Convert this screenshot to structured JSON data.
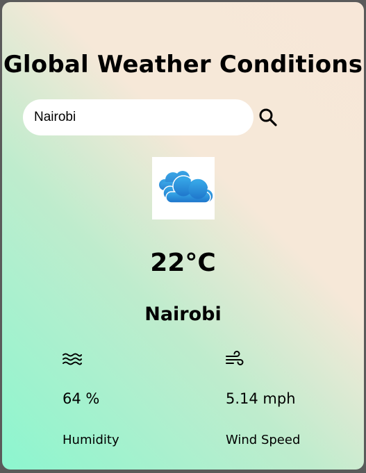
{
  "app": {
    "title": "Global Weather Conditions"
  },
  "search": {
    "value": "Nairobi"
  },
  "weather": {
    "icon": "cloud-icon",
    "temperature": "22°C",
    "city": "Nairobi"
  },
  "stats": {
    "humidity": {
      "icon": "humidity-waves-icon",
      "value": "64 %",
      "label": "Humidity"
    },
    "wind": {
      "icon": "wind-icon",
      "value": "5.14 mph",
      "label": "Wind Speed"
    }
  },
  "colors": {
    "gradient_start": "#8cf6cf",
    "gradient_end": "#f7e7d8",
    "cloud_blue": "#2f8fd8",
    "search_bg": "#ffffff"
  }
}
